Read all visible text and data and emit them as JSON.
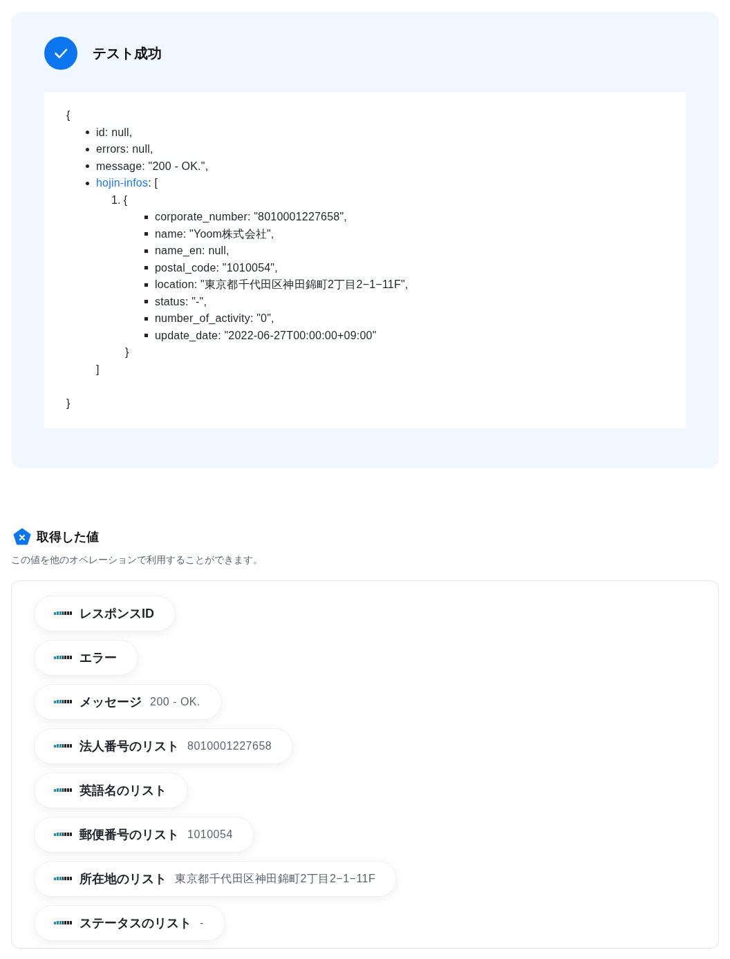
{
  "test_result": {
    "title": "テスト成功",
    "response": {
      "open": "{",
      "items": [
        {
          "text": "id: null,"
        },
        {
          "text": "errors: null,"
        },
        {
          "text": "message: \"200 - OK.\","
        },
        {
          "key": "hojin-infos",
          "text": ": [",
          "entries": [
            {
              "number": "1.",
              "open": "{",
              "items": [
                {
                  "text": "corporate_number: \"8010001227658\","
                },
                {
                  "text": "name: \"Yoom株式会社\","
                },
                {
                  "text": "name_en: null,"
                },
                {
                  "text": "postal_code: \"1010054\","
                },
                {
                  "text": "location: \"東京都千代田区神田錦町2丁目2−1−11F\","
                },
                {
                  "text": "status: \"-\","
                },
                {
                  "text": "number_of_activity: \"0\","
                },
                {
                  "text": "update_date: \"2022-06-27T00:00:00+09:00\""
                }
              ],
              "close": "}"
            }
          ],
          "close": "]"
        }
      ],
      "close": "}"
    }
  },
  "output_values": {
    "title": "取得した値",
    "description": "この値を他のオペレーションで利用することができます。",
    "items": [
      {
        "label": "レスポンスID"
      },
      {
        "label": "エラー"
      },
      {
        "label": "メッセージ",
        "value": "200 - OK."
      },
      {
        "label": "法人番号のリスト",
        "value": "8010001227658"
      },
      {
        "label": "英語名のリスト"
      },
      {
        "label": "郵便番号のリスト",
        "value": "1010054"
      },
      {
        "label": "所在地のリスト",
        "value": "東京都千代田区神田錦町2丁目2−1−11F"
      },
      {
        "label": "ステータスのリスト",
        "value": "-"
      }
    ]
  }
}
